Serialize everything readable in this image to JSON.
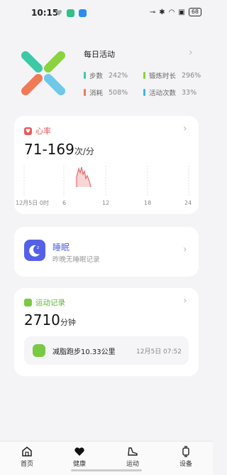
{
  "status_bar": {
    "time": "10:15",
    "battery": "68"
  },
  "summary": {
    "title": "每日活动",
    "stats": [
      {
        "label": "步数",
        "value": "242%",
        "color": "#3bc9a8"
      },
      {
        "label": "锻炼时长",
        "value": "296%",
        "color": "#8ad33e"
      },
      {
        "label": "消耗",
        "value": "508%",
        "color": "#f07a55"
      },
      {
        "label": "活动次数",
        "value": "33%",
        "color": "#3fb6e8"
      }
    ]
  },
  "heart_rate": {
    "title": "心率",
    "value": "71-169",
    "unit": "次/分",
    "x_labels": [
      "12月5日 0时",
      "6",
      "12",
      "18",
      "24"
    ],
    "line_color": "#e36a6a"
  },
  "sleep": {
    "title": "睡眠",
    "subtitle": "昨晚无睡眠记录"
  },
  "exercise": {
    "title": "运动记录",
    "value": "2710",
    "unit": "分钟",
    "item_name": "减脂跑步10.33公里",
    "item_date": "12月5日 07:52"
  },
  "bottom_nav": [
    {
      "label": "首页",
      "icon": "home-icon"
    },
    {
      "label": "健康",
      "icon": "heart-icon"
    },
    {
      "label": "运动",
      "icon": "shoe-icon"
    },
    {
      "label": "设备",
      "icon": "watch-icon"
    }
  ]
}
